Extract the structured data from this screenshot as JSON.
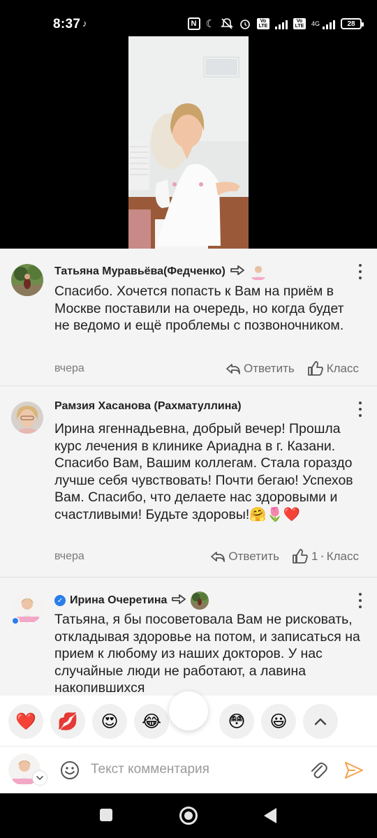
{
  "status_bar": {
    "time": "8:37",
    "network_label": "4G",
    "battery_level": "28"
  },
  "comments": [
    {
      "author": "Татьяна Муравьёва(Федченко)",
      "text": "Спасибо. Хочется попасть к Вам на приём в Москве поставили на очередь, но когда будет не ведомо и ещё проблемы с позвоночником.",
      "time": "вчера",
      "reply_label": "Ответить",
      "like_label": "Класс",
      "like_count": ""
    },
    {
      "author": "Рамзия Хасанова (Рахматуллина)",
      "text": "Ирина ягеннадьевна, добрый вечер! Прошла курс лечения в клинике Ариадна в г. Казани. Спасибо Вам, Вашим коллегам. Стала гораздо лучше себя чувствовать! Почти бегаю! Успехов Вам. Спасибо, что делаете нас здоровыми и счастливыми! Будьте здоровы!🤗🌷❤️",
      "time": "вчера",
      "reply_label": "Ответить",
      "like_label": "Класс",
      "like_count": "1",
      "like_separator": "•"
    },
    {
      "author": "Ирина Очеретина",
      "text": "Татьяна, я бы посоветовала Вам не рисковать, откладывая здоровье на потом, и записаться на прием к любому из наших докторов. У нас случайные люди не работают, а лавина накопившихся",
      "verified": true
    }
  ],
  "reactions": [
    "❤️",
    "💋",
    "😍",
    "😂",
    "",
    "😳",
    "😃"
  ],
  "input": {
    "placeholder": "Текст комментария"
  },
  "colors": {
    "panel_bg": "#f4f4f5",
    "accent_send": "#f7a24a",
    "verified": "#2b7de9"
  }
}
